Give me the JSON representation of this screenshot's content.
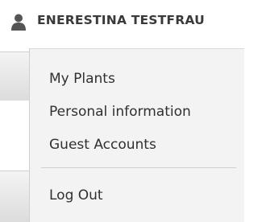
{
  "user": {
    "icon": "user-icon",
    "name": "ENERESTINA TESTFRAU"
  },
  "menu": {
    "items": [
      {
        "label": "My Plants"
      },
      {
        "label": "Personal information"
      },
      {
        "label": "Guest Accounts"
      }
    ],
    "logout_label": "Log Out"
  },
  "colors": {
    "menu_background": "#f3f3f3",
    "text": "#303030",
    "username_text": "#3a3a3a",
    "icon": "#555555"
  }
}
